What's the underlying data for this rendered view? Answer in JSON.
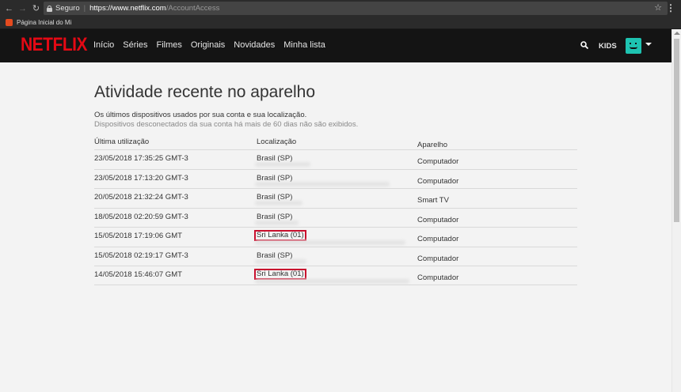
{
  "browser": {
    "secure_label": "Seguro",
    "url_host": "https://www.netflix.com",
    "url_path": "/AccountAccess",
    "bookmark_label": "Página Inicial do Mi"
  },
  "header": {
    "logo": "NETFLIX",
    "nav": [
      "Início",
      "Séries",
      "Filmes",
      "Originais",
      "Novidades",
      "Minha lista"
    ],
    "kids_label": "KIDS"
  },
  "page": {
    "title": "Atividade recente no aparelho",
    "description": "Os últimos dispositivos usados por sua conta e sua localização.",
    "note": "Dispositivos desconectados da sua conta há mais de 60 dias não são exibidos."
  },
  "table": {
    "columns": [
      "Última utilização",
      "Localização",
      "Aparelho"
    ],
    "rows": [
      {
        "time": "23/05/2018 17:35:25 GMT-3",
        "location": "Brasil (SP)",
        "device": "Computador",
        "flagged": false
      },
      {
        "time": "23/05/2018 17:13:20 GMT-3",
        "location": "Brasil (SP)",
        "device": "Computador",
        "flagged": false
      },
      {
        "time": "20/05/2018 21:32:24 GMT-3",
        "location": "Brasil (SP)",
        "device": "Smart TV",
        "flagged": false
      },
      {
        "time": "18/05/2018 02:20:59 GMT-3",
        "location": "Brasil (SP)",
        "device": "Computador",
        "flagged": false
      },
      {
        "time": "15/05/2018 17:19:06 GMT",
        "location": "Sri Lanka (01)",
        "device": "Computador",
        "flagged": true
      },
      {
        "time": "15/05/2018 02:19:17 GMT-3",
        "location": "Brasil (SP)",
        "device": "Computador",
        "flagged": false
      },
      {
        "time": "14/05/2018 15:46:07 GMT",
        "location": "Sri Lanka (01)",
        "device": "Computador",
        "flagged": true
      }
    ]
  },
  "colors": {
    "netflix_red": "#e50914",
    "highlight_border": "#c8102e",
    "avatar": "#1ec3b1"
  }
}
